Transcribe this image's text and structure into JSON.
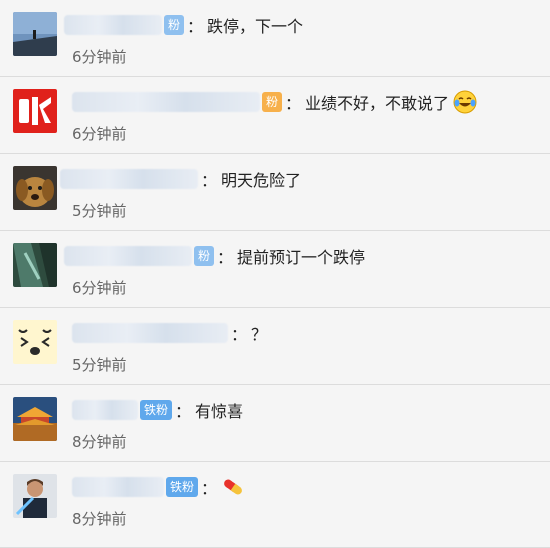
{
  "comments": [
    {
      "fan_badge": "粉",
      "message": "跌停，下一个",
      "time": "6分钟前",
      "avatar": "landscape-avatar"
    },
    {
      "fan_badge": "粉",
      "message": "业绩不好，不敢说了",
      "time": "6分钟前",
      "avatar": "red-zhang-avatar",
      "emoji": "laughing-crying-emoji"
    },
    {
      "fan_badge": "",
      "message": "明天危险了",
      "time": "5分钟前",
      "avatar": "dog-avatar"
    },
    {
      "fan_badge": "粉",
      "message": "提前预订一个跌停",
      "time": "6分钟前",
      "avatar": "green-tunnel-avatar"
    },
    {
      "fan_badge": "",
      "message": "？",
      "time": "5分钟前",
      "avatar": "cartoon-face-avatar"
    },
    {
      "fan_badge": "铁粉",
      "message": "有惊喜",
      "time": "8分钟前",
      "avatar": "pagoda-avatar"
    },
    {
      "fan_badge": "铁粉",
      "message": "",
      "time": "8分钟前",
      "avatar": "person-avatar",
      "emoji": "pill-emoji"
    }
  ],
  "colors": {
    "fan_badge": "#8fc0ef",
    "fan_badge_orange": "#f7b04b",
    "text": "#222222",
    "time": "#666666"
  }
}
